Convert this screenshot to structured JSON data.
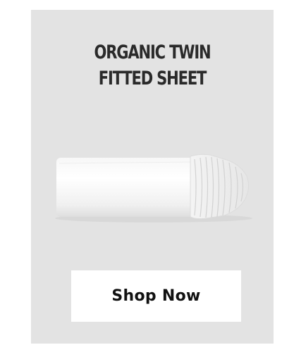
{
  "product": {
    "title_line1": "ORGANIC TWIN",
    "title_line2": "FITTED SHEET",
    "image_icon": "rolled-fitted-sheet-image"
  },
  "cta": {
    "label": "Shop Now"
  },
  "colors": {
    "card_background": "#e3e3e3",
    "page_background": "#ffffff",
    "button_background": "#ffffff",
    "title_text": "#2a2a2a",
    "button_text": "#111111"
  }
}
